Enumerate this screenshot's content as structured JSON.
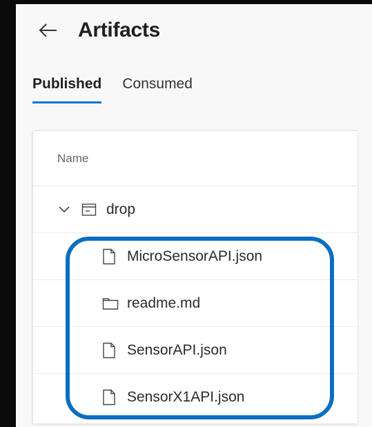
{
  "page": {
    "title": "Artifacts"
  },
  "tabs": [
    {
      "label": "Published",
      "active": true
    },
    {
      "label": "Consumed",
      "active": false
    }
  ],
  "table": {
    "column_header": "Name",
    "folder": {
      "name": "drop",
      "icon": "archive-icon",
      "expanded": true
    },
    "files": [
      {
        "name": "MicroSensorAPI.json",
        "icon": "file-icon"
      },
      {
        "name": "readme.md",
        "icon": "folder-icon"
      },
      {
        "name": "SensorAPI.json",
        "icon": "file-icon"
      },
      {
        "name": "SensorX1API.json",
        "icon": "file-icon"
      }
    ]
  },
  "colors": {
    "accent": "#1174cc",
    "highlight": "#0a6fc2"
  }
}
